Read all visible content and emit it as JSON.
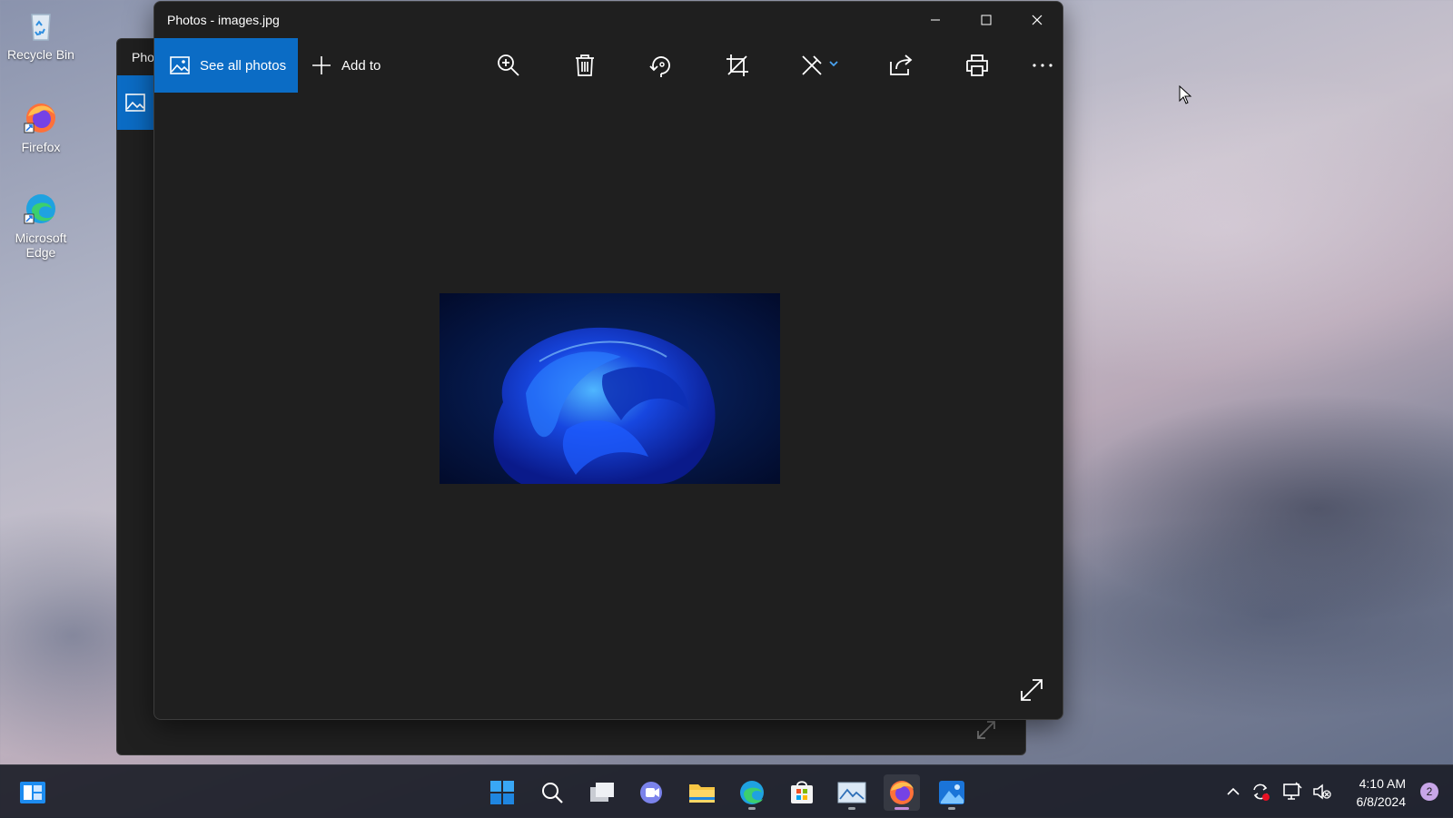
{
  "desktop": {
    "icons": [
      {
        "label": "Recycle Bin"
      },
      {
        "label": "Firefox"
      },
      {
        "label": "Microsoft Edge"
      }
    ]
  },
  "background_window": {
    "title": "Pho"
  },
  "photos_window": {
    "title": "Photos - images.jpg",
    "toolbar": {
      "see_all_photos": "See all photos",
      "add_to": "Add to"
    },
    "toolbar_icons": [
      "zoom-in-icon",
      "delete-icon",
      "rotate-icon",
      "crop-icon",
      "edit-icon",
      "share-icon",
      "print-icon",
      "more-icon"
    ],
    "image_file": "images.jpg"
  },
  "taskbar": {
    "apps": [
      "start",
      "search",
      "task-view",
      "chat",
      "file-explorer",
      "edge",
      "store",
      "photos-viewer",
      "firefox",
      "photos"
    ],
    "clock": {
      "time": "4:10 AM",
      "date": "6/8/2024"
    },
    "notification_count": "2"
  },
  "colors": {
    "accent": "#0b6cc5",
    "window_bg": "#1f1f1f",
    "taskbar_bg": "#1c1e28"
  }
}
